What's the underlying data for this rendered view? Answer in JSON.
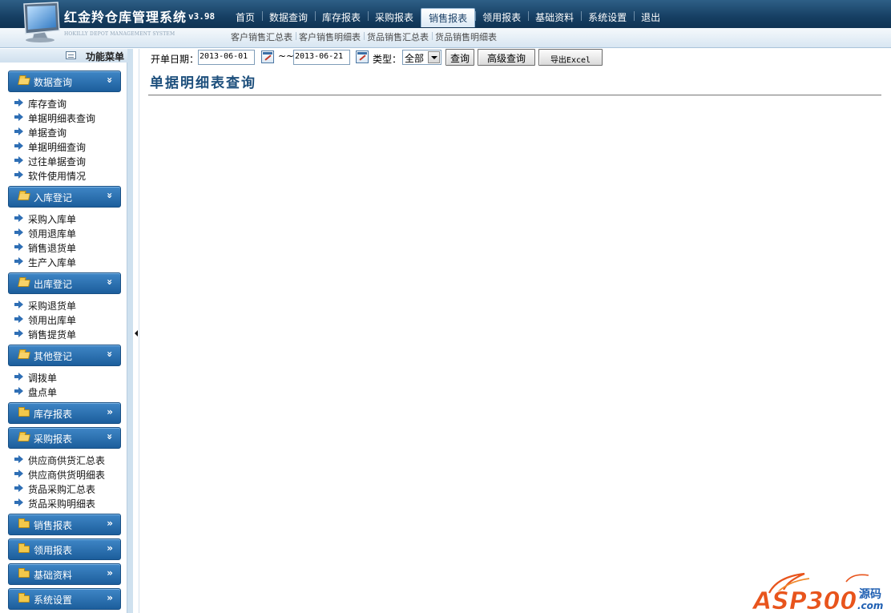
{
  "header": {
    "app_title": "红金羚仓库管理系统",
    "version": "v3.98",
    "subtitle": "HOKILLY DEPOT MANAGEMENT SYSTEM",
    "nav": [
      {
        "label": "首页",
        "active": false
      },
      {
        "label": "数据查询",
        "active": false
      },
      {
        "label": "库存报表",
        "active": false
      },
      {
        "label": "采购报表",
        "active": false
      },
      {
        "label": "销售报表",
        "active": true
      },
      {
        "label": "领用报表",
        "active": false
      },
      {
        "label": "基础资料",
        "active": false
      },
      {
        "label": "系统设置",
        "active": false
      },
      {
        "label": "退出",
        "active": false
      }
    ],
    "subnav": [
      "客户销售汇总表",
      "客户销售明细表",
      "货品销售汇总表",
      "货品销售明细表"
    ]
  },
  "sidebar": {
    "title": "功能菜单",
    "groups": [
      {
        "label": "数据查询",
        "expanded": true,
        "toggle": "»",
        "items": [
          "库存查询",
          "单据明细表查询",
          "单据查询",
          "单据明细查询",
          "过往单据查询",
          "软件使用情况"
        ]
      },
      {
        "label": "入库登记",
        "expanded": true,
        "toggle": "»",
        "items": [
          "采购入库单",
          "领用退库单",
          "销售退货单",
          "生产入库单"
        ]
      },
      {
        "label": "出库登记",
        "expanded": true,
        "toggle": "»",
        "items": [
          "采购退货单",
          "领用出库单",
          "销售提货单"
        ]
      },
      {
        "label": "其他登记",
        "expanded": true,
        "toggle": "»",
        "items": [
          "调拨单",
          "盘点单"
        ]
      },
      {
        "label": "库存报表",
        "expanded": false,
        "toggle": "»",
        "items": []
      },
      {
        "label": "采购报表",
        "expanded": true,
        "toggle": "»",
        "items": [
          "供应商供货汇总表",
          "供应商供货明细表",
          "货品采购汇总表",
          "货品采购明细表"
        ]
      },
      {
        "label": "销售报表",
        "expanded": false,
        "toggle": "»",
        "items": []
      },
      {
        "label": "领用报表",
        "expanded": false,
        "toggle": "»",
        "items": []
      },
      {
        "label": "基础资料",
        "expanded": false,
        "toggle": "»",
        "items": []
      },
      {
        "label": "系统设置",
        "expanded": false,
        "toggle": "»",
        "items": []
      }
    ]
  },
  "toolbar": {
    "date_label": "开单日期：",
    "date_from": "2013-06-01",
    "date_sep": "~~",
    "date_to": "2013-06-21",
    "type_label": "类型：",
    "type_value": "全部",
    "search_button": "查询",
    "advanced_button": "高级查询",
    "export_button": "导出Excel"
  },
  "main": {
    "page_title": "单据明细表查询"
  },
  "watermark": {
    "brand_left": "ASP300",
    "brand_right_top": "源码",
    "brand_right_bottom": ".com"
  },
  "colors": {
    "header_bg": "#163f63",
    "menu_group_bg": "#2a6fb0",
    "title_text": "#1d4f7c",
    "watermark_orange": "#e8541c",
    "watermark_blue": "#1f5fb2"
  }
}
